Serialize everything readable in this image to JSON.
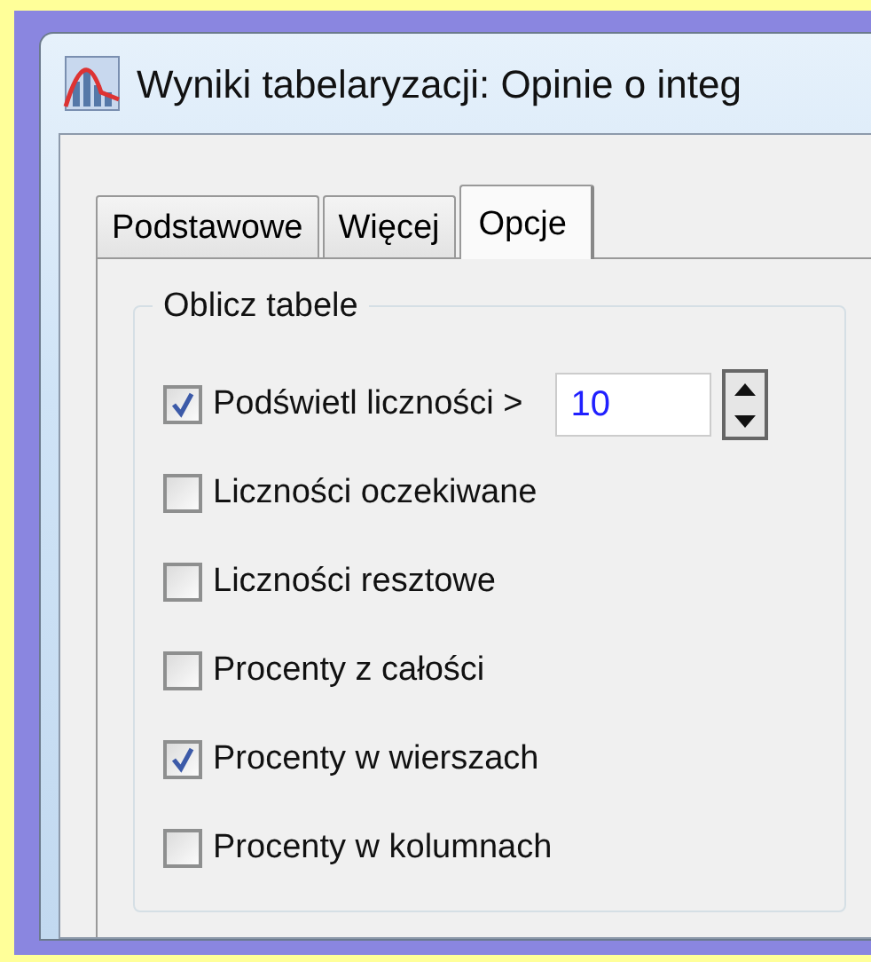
{
  "window": {
    "title": "Wyniki tabelaryzacji: Opinie o integ"
  },
  "tabs": [
    {
      "label": "Podstawowe",
      "selected": false
    },
    {
      "label": "Więcej",
      "selected": false
    },
    {
      "label": "Opcje",
      "selected": true
    }
  ],
  "group": {
    "title": "Oblicz tabele",
    "options": [
      {
        "label": "Podświetl liczności >",
        "checked": true,
        "value": "10"
      },
      {
        "label": "Liczności oczekiwane",
        "checked": false
      },
      {
        "label": "Liczności resztowe",
        "checked": false
      },
      {
        "label": "Procenty z całości",
        "checked": false
      },
      {
        "label": "Procenty w wierszach",
        "checked": true
      },
      {
        "label": "Procenty w kolumnach",
        "checked": false
      }
    ]
  }
}
